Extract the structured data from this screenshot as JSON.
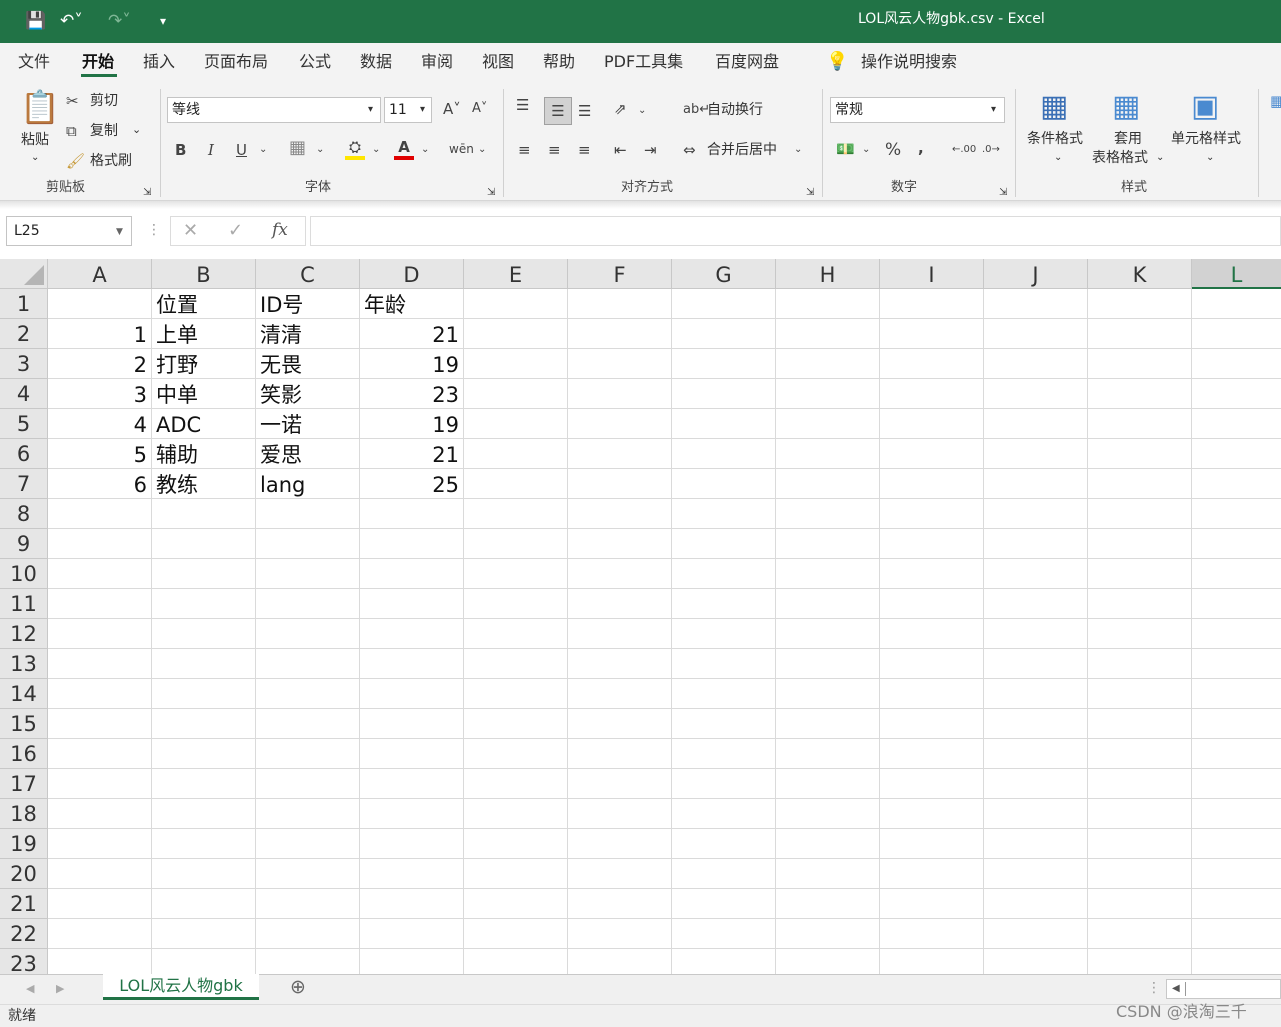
{
  "titlebar": {
    "window_title": "LOL风云人物gbk.csv  -  Excel"
  },
  "menu": [
    "文件",
    "开始",
    "插入",
    "页面布局",
    "公式",
    "数据",
    "审阅",
    "视图",
    "帮助",
    "PDF工具集",
    "百度网盘"
  ],
  "search": {
    "label": "操作说明搜索"
  },
  "ribbon": {
    "clipboard": {
      "group": "剪贴板",
      "paste": "粘贴",
      "cut": "剪切",
      "copy": "复制",
      "painter": "格式刷"
    },
    "font": {
      "group": "字体",
      "font_name": "等线",
      "font_size": "11"
    },
    "align": {
      "group": "对齐方式",
      "wrap": "自动换行",
      "merge": "合并后居中"
    },
    "number": {
      "group": "数字",
      "format": "常规"
    },
    "styles": {
      "group": "样式",
      "conditional": "条件格式",
      "table_l1": "套用",
      "table_l2": "表格格式",
      "cell_styles": "单元格样式"
    }
  },
  "formula_bar": {
    "name_box": "L25",
    "content": ""
  },
  "columns": [
    "A",
    "B",
    "C",
    "D",
    "E",
    "F",
    "G",
    "H",
    "I",
    "J",
    "K",
    "L"
  ],
  "rows": [
    "1",
    "2",
    "3",
    "4",
    "5",
    "6",
    "7",
    "8",
    "9",
    "10",
    "11",
    "12",
    "13",
    "14",
    "15",
    "16",
    "17",
    "18",
    "19",
    "20",
    "21",
    "22",
    "23"
  ],
  "cells": [
    [
      "",
      "位置",
      "ID号",
      "年龄"
    ],
    [
      "1",
      "上单",
      "清清",
      "21"
    ],
    [
      "2",
      "打野",
      "无畏",
      "19"
    ],
    [
      "3",
      "中单",
      "笑影",
      "23"
    ],
    [
      "4",
      "ADC",
      "一诺",
      "19"
    ],
    [
      "5",
      "辅助",
      "爱思",
      "21"
    ],
    [
      "6",
      "教练",
      "lang",
      "25"
    ]
  ],
  "sheet_tab": "LOL风云人物gbk",
  "status": {
    "ready": "就绪",
    "watermark": "CSDN @浪淘三千"
  }
}
